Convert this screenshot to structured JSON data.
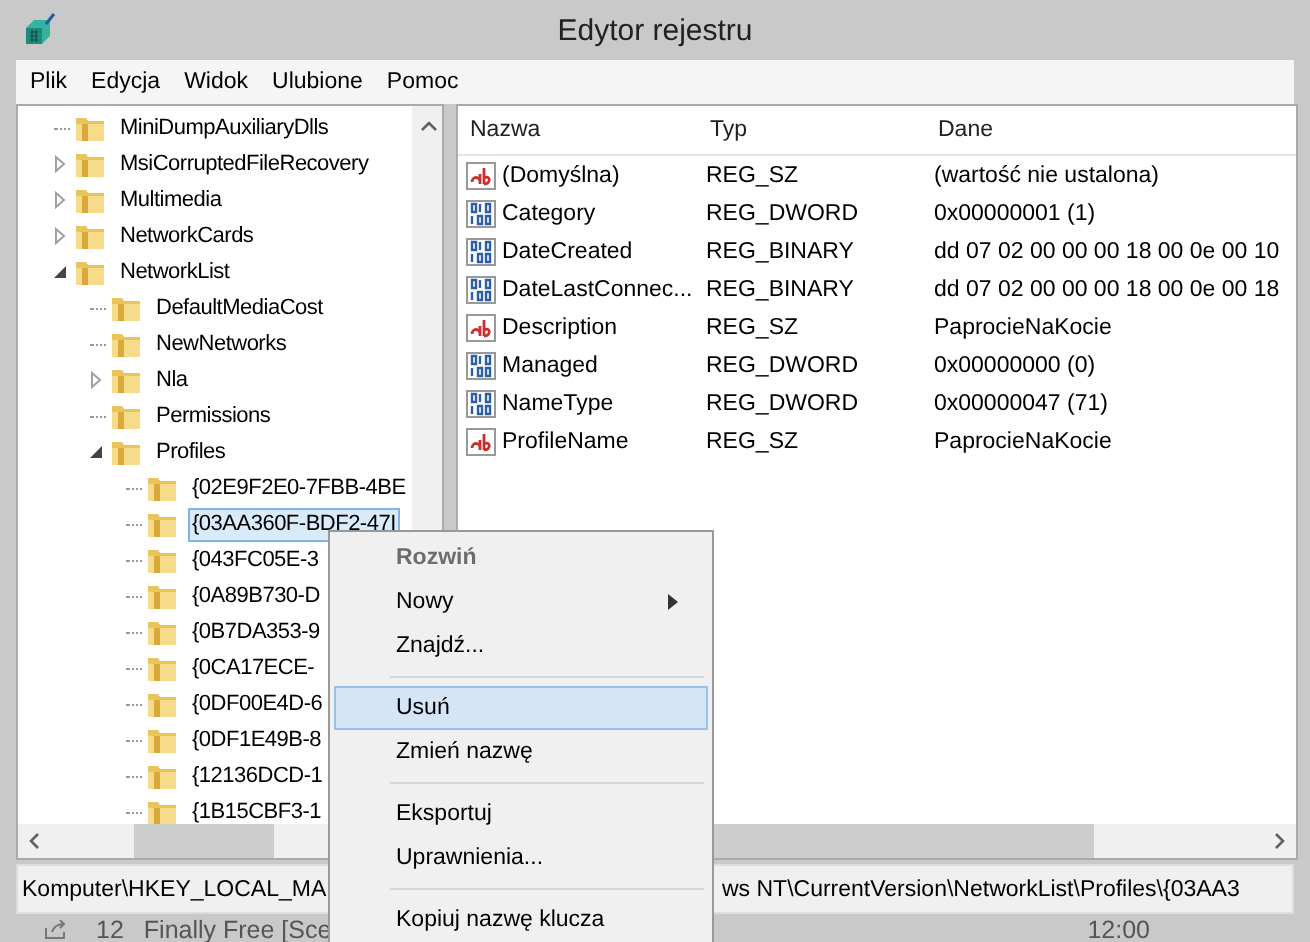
{
  "window": {
    "title": "Edytor rejestru"
  },
  "menu_bar": [
    "Plik",
    "Edycja",
    "Widok",
    "Ulubione",
    "Pomoc"
  ],
  "tree": {
    "items": [
      {
        "kind": "leaf",
        "label": "MiniDumpAuxiliaryDlls",
        "selected": false
      },
      {
        "kind": "node",
        "label": "MsiCorruptedFileRecovery",
        "expanded": false,
        "selected": false
      },
      {
        "kind": "node",
        "label": "Multimedia",
        "expanded": false,
        "selected": false
      },
      {
        "kind": "node",
        "label": "NetworkCards",
        "expanded": false,
        "selected": false
      },
      {
        "kind": "node",
        "label": "NetworkList",
        "expanded": true,
        "selected": false,
        "children": [
          {
            "kind": "leaf",
            "label": "DefaultMediaCost",
            "selected": false
          },
          {
            "kind": "leaf",
            "label": "NewNetworks",
            "selected": false
          },
          {
            "kind": "node",
            "label": "Nla",
            "expanded": false,
            "selected": false
          },
          {
            "kind": "leaf",
            "label": "Permissions",
            "selected": false
          },
          {
            "kind": "node",
            "label": "Profiles",
            "expanded": true,
            "selected": false,
            "children": [
              {
                "kind": "leaf",
                "label": "{02E9F2E0-7FBB-4BE",
                "selected": false
              },
              {
                "kind": "leaf",
                "label": "{03AA360F-BDF2-47I",
                "selected": true
              },
              {
                "kind": "leaf",
                "label": "{043FC05E-3",
                "selected": false
              },
              {
                "kind": "leaf",
                "label": "{0A89B730-D",
                "selected": false
              },
              {
                "kind": "leaf",
                "label": "{0B7DA353-9",
                "selected": false
              },
              {
                "kind": "leaf",
                "label": "{0CA17ECE-",
                "selected": false
              },
              {
                "kind": "leaf",
                "label": "{0DF00E4D-6",
                "selected": false
              },
              {
                "kind": "leaf",
                "label": "{0DF1E49B-8",
                "selected": false
              },
              {
                "kind": "leaf",
                "label": "{12136DCD-1",
                "selected": false
              },
              {
                "kind": "leaf",
                "label": "{1B15CBF3-1",
                "selected": false
              }
            ]
          }
        ]
      }
    ]
  },
  "values": {
    "columns": [
      "Nazwa",
      "Typ",
      "Dane"
    ],
    "rows": [
      {
        "kind": "string",
        "name": "(Domyślna)",
        "type": "REG_SZ",
        "data": "(wartość nie ustalona)"
      },
      {
        "kind": "binary",
        "name": "Category",
        "type": "REG_DWORD",
        "data": "0x00000001 (1)"
      },
      {
        "kind": "binary",
        "name": "DateCreated",
        "type": "REG_BINARY",
        "data": "dd 07 02 00 00 00 18 00 0e 00 10"
      },
      {
        "kind": "binary",
        "name": "DateLastConnec...",
        "type": "REG_BINARY",
        "data": "dd 07 02 00 00 00 18 00 0e 00 18"
      },
      {
        "kind": "string",
        "name": "Description",
        "type": "REG_SZ",
        "data": "PaprocieNaKocie"
      },
      {
        "kind": "binary",
        "name": "Managed",
        "type": "REG_DWORD",
        "data": "0x00000000 (0)"
      },
      {
        "kind": "binary",
        "name": "NameType",
        "type": "REG_DWORD",
        "data": "0x00000047 (71)"
      },
      {
        "kind": "string",
        "name": "ProfileName",
        "type": "REG_SZ",
        "data": "PaprocieNaKocie"
      }
    ]
  },
  "status_bar": {
    "text_left": "Komputer\\HKEY_LOCAL_MA",
    "text_right": "ws NT\\CurrentVersion\\NetworkList\\Profiles\\{03AA3"
  },
  "context_menu": {
    "items": [
      {
        "kind": "item",
        "label": "Rozwiń",
        "bold": true,
        "selected": false,
        "submenu": false
      },
      {
        "kind": "item",
        "label": "Nowy",
        "bold": false,
        "selected": false,
        "submenu": true
      },
      {
        "kind": "item",
        "label": "Znajdź...",
        "bold": false,
        "selected": false,
        "submenu": false
      },
      {
        "kind": "separator"
      },
      {
        "kind": "item",
        "label": "Usuń",
        "bold": false,
        "selected": true,
        "submenu": false
      },
      {
        "kind": "item",
        "label": "Zmień nazwę",
        "bold": false,
        "selected": false,
        "submenu": false
      },
      {
        "kind": "separator"
      },
      {
        "kind": "item",
        "label": "Eksportuj",
        "bold": false,
        "selected": false,
        "submenu": false
      },
      {
        "kind": "item",
        "label": "Uprawnienia...",
        "bold": false,
        "selected": false,
        "submenu": false
      },
      {
        "kind": "separator"
      },
      {
        "kind": "item",
        "label": "Kopiuj nazwę klucza",
        "bold": false,
        "selected": false,
        "submenu": false
      }
    ]
  },
  "taskbar": {
    "track_number": "12",
    "track_title": "Finally Free [Sce",
    "time": "12:00"
  }
}
